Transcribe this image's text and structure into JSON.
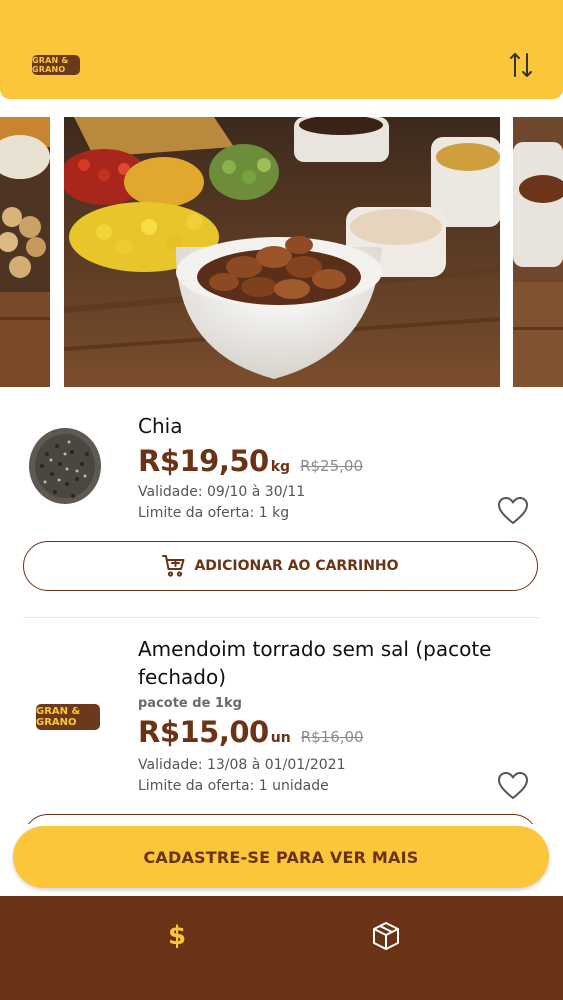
{
  "header": {
    "logo_text": "GRAN & GRANO",
    "sort_icon": "sort-arrows-icon",
    "color": "#fcc63a"
  },
  "products": [
    {
      "title": "Chia",
      "price": "R$19,50",
      "price_unit": "kg",
      "old_price": "R$25,00",
      "validity": "Validade: 09/10 à 30/11",
      "limit": "Limite da oferta: 1 kg",
      "button_label": "ADICIONAR AO CARRINHO"
    },
    {
      "title_line1": "Amendoim torrado sem sal (pacote",
      "title_line2": "fechado)",
      "unit_desc": "pacote de 1kg",
      "price": "R$15,00",
      "price_unit": "un",
      "old_price": "R$16,00",
      "validity": "Validade: 13/08 à 01/01/2021",
      "limit": "Limite da oferta: 1 unidade",
      "logo_text": "GRAN & GRANO"
    }
  ],
  "register_button": "CADASTRE-SE PARA VER MAIS",
  "bottom_nav": {
    "offers_symbol": "$",
    "offers_icon": "dollar-icon",
    "products_icon": "box-icon"
  },
  "colors": {
    "accent": "#fcc63a",
    "brown": "#6b3316"
  }
}
